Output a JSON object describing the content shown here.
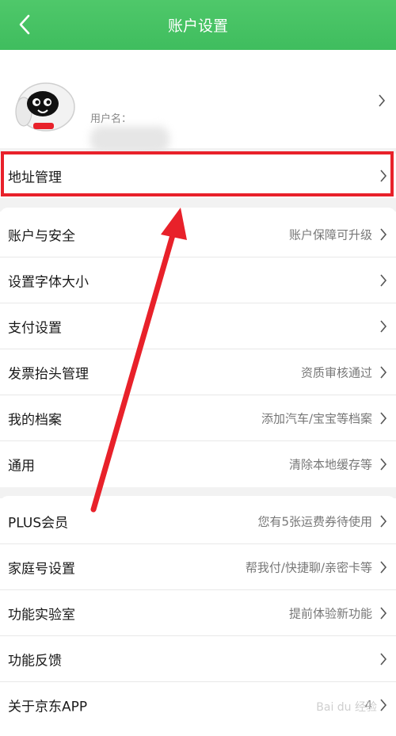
{
  "header": {
    "title": "账户设置",
    "back_icon": "chevron-left-icon"
  },
  "profile": {
    "name_fragment": "",
    "username_label": "用户名："
  },
  "address_row": {
    "label": "地址管理"
  },
  "group1": [
    {
      "label": "账户与安全",
      "value": "账户保障可升级"
    },
    {
      "label": "设置字体大小",
      "value": ""
    },
    {
      "label": "支付设置",
      "value": ""
    },
    {
      "label": "发票抬头管理",
      "value": "资质审核通过"
    },
    {
      "label": "我的档案",
      "value": "添加汽车/宝宝等档案"
    },
    {
      "label": "通用",
      "value": "清除本地缓存等"
    }
  ],
  "group2": [
    {
      "label": "PLUS会员",
      "value": "您有5张运费券待使用"
    },
    {
      "label": "家庭号设置",
      "value": "帮我付/快捷聊/亲密卡等"
    },
    {
      "label": "功能实验室",
      "value": "提前体验新功能"
    },
    {
      "label": "功能反馈",
      "value": ""
    },
    {
      "label": "关于京东APP",
      "value": "4"
    }
  ],
  "colors": {
    "header_green": "#3fbd5e",
    "highlight_red": "#e8212a"
  },
  "watermark": "Bai du 经验"
}
